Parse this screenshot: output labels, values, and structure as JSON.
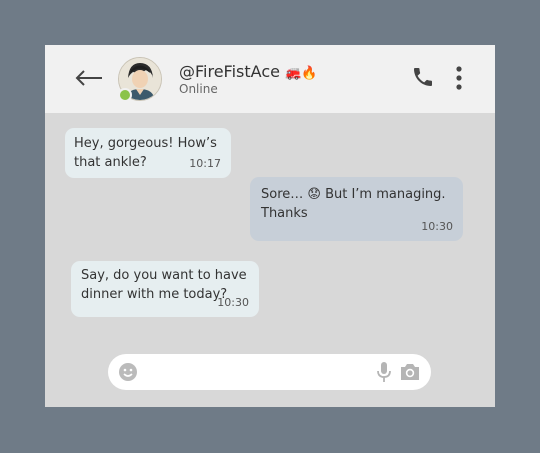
{
  "contact": {
    "name": "@FireFistAce",
    "emoji": "🚒🔥",
    "status": "Online"
  },
  "messages": [
    {
      "direction": "incoming",
      "text": "Hey, gorgeous! How’s that ankle?",
      "time": "10:17"
    },
    {
      "direction": "outgoing",
      "text": "Sore… 😟 But I’m managing. Thanks",
      "time": "10:30"
    },
    {
      "direction": "incoming",
      "text": "Say, do you want to have dinner with me today?",
      "time": "10:30"
    }
  ],
  "composer": {
    "placeholder": ""
  },
  "icons": [
    "back-arrow-icon",
    "avatar",
    "phone-icon",
    "more-vertical-icon",
    "emoji-icon",
    "microphone-icon",
    "camera-icon"
  ],
  "colors": {
    "page_background": "#6f7b87",
    "header_background": "#f1f1f1",
    "chat_background": "#d8d8d8",
    "incoming_bubble": "#e6eef0",
    "outgoing_bubble": "#c7cfd8",
    "online_indicator": "#8bc34a"
  }
}
